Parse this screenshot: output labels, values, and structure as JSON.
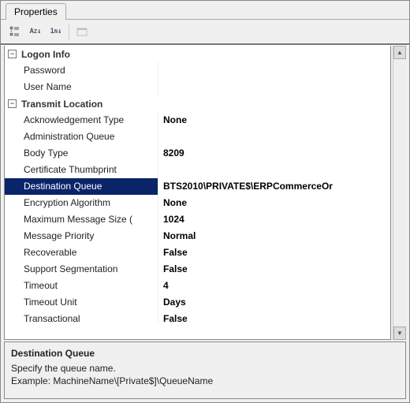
{
  "tab_label": "Properties",
  "toolbar": {
    "categorized": "Categorized",
    "alphabetical": "Alphabetical",
    "sort_n": "Sort",
    "pages": "Property Pages"
  },
  "categories": [
    {
      "name": "Logon Info",
      "expanded": true,
      "rows": [
        {
          "label": "Password",
          "value": ""
        },
        {
          "label": "User Name",
          "value": ""
        }
      ]
    },
    {
      "name": "Transmit Location",
      "expanded": true,
      "rows": [
        {
          "label": "Acknowledgement Type",
          "value": "None"
        },
        {
          "label": "Administration Queue",
          "value": ""
        },
        {
          "label": "Body Type",
          "value": "8209"
        },
        {
          "label": "Certificate Thumbprint",
          "value": ""
        },
        {
          "label": "Destination Queue",
          "value": "BTS2010\\PRIVATE$\\ERPCommerceOr",
          "selected": true
        },
        {
          "label": "Encryption Algorithm",
          "value": "None"
        },
        {
          "label": "Maximum Message Size (",
          "value": "1024"
        },
        {
          "label": "Message Priority",
          "value": "Normal"
        },
        {
          "label": "Recoverable",
          "value": "False"
        },
        {
          "label": "Support Segmentation",
          "value": "False"
        },
        {
          "label": "Timeout",
          "value": "4"
        },
        {
          "label": "Timeout Unit",
          "value": "Days"
        },
        {
          "label": "Transactional",
          "value": "False",
          "partial": true
        }
      ]
    }
  ],
  "description": {
    "title": "Destination Queue",
    "line1": "Specify the queue name.",
    "line2": "Example: MachineName\\[Private$]\\QueueName"
  }
}
